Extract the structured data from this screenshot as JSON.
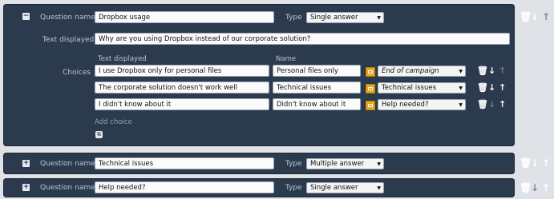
{
  "questions": [
    {
      "question_name_label": "Question name",
      "name_value": "Dropbox usage",
      "type_label": "Type",
      "type_value": "Single answer",
      "text_displayed_label": "Text displayed",
      "text_value": "Why are you using Dropbox instead of our corporate solution?",
      "choices_label": "Choices",
      "col_text_displayed": "Text displayed",
      "col_name": "Name",
      "choices": [
        {
          "text": "I use Dropbox only for personal files",
          "name": "Personal files only",
          "target": "End of campaign"
        },
        {
          "text": "The corporate solution doesn't work well",
          "name": "Technical issues",
          "target": "Technical issues"
        },
        {
          "text": "I didn't know about it",
          "name": "Didn't know about it",
          "target": "Help needed?"
        }
      ],
      "add_choice_label": "Add choice",
      "toggle": "−"
    },
    {
      "question_name_label": "Question name",
      "name_value": "Technical issues",
      "type_label": "Type",
      "type_value": "Multiple answer",
      "toggle": "+"
    },
    {
      "question_name_label": "Question name",
      "name_value": "Help needed?",
      "type_label": "Type",
      "type_value": "Single answer",
      "toggle": "+"
    }
  ],
  "icons": {
    "delete": "trash-icon",
    "move_down": "arrow-down-icon",
    "move_up": "arrow-up-icon",
    "dropdown": "caret-down-icon",
    "link": "tag-icon"
  }
}
